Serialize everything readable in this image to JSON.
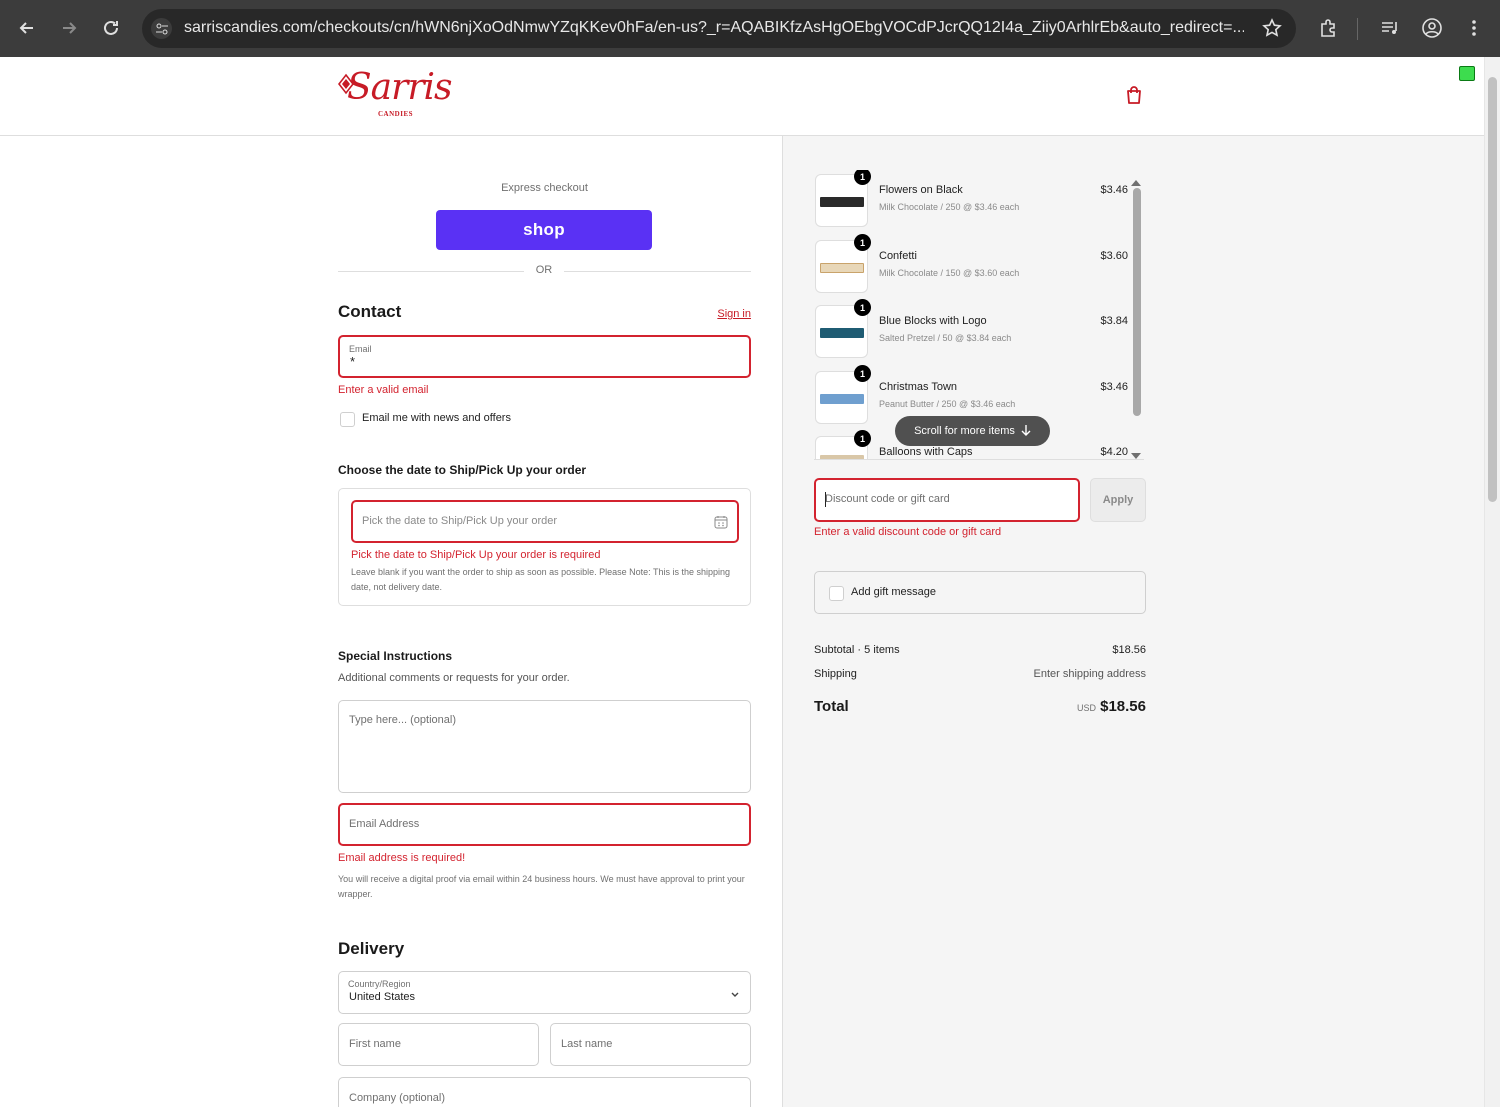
{
  "browser": {
    "url": "sarriscandies.com/checkouts/cn/hWN6njXoOdNmwYZqKKev0hFa/en-us?_r=AQABIKfzAsHgOEbgVOCdPJcrQQ12I4a_Ziiy0ArhlrEb&auto_redirect=..."
  },
  "brand": {
    "logo_text": "Sarris",
    "logo_sub": "CANDIES",
    "accent": "#c71b26"
  },
  "express": {
    "label": "Express checkout",
    "shop_label": "shop",
    "or_label": "OR"
  },
  "contact": {
    "heading": "Contact",
    "signin": "Sign in",
    "email_label": "Email",
    "email_value": "*",
    "email_error": "Enter a valid email",
    "newsletter_label": "Email me with news and offers"
  },
  "ship_date": {
    "heading": "Choose the date to Ship/Pick Up your order",
    "placeholder": "Pick the date to Ship/Pick Up your order",
    "error": "Pick the date to Ship/Pick Up your order is required",
    "note": "Leave blank if you want the order to ship as soon as possible. Please Note: This is the shipping date, not delivery date."
  },
  "special": {
    "heading": "Special Instructions",
    "description": "Additional comments or requests for your order.",
    "textarea_placeholder": "Type here... (optional)",
    "email_placeholder": "Email Address",
    "email_error": "Email address is required!",
    "note": "You will receive a digital proof via email within 24 business hours. We must have approval to print your wrapper."
  },
  "delivery": {
    "heading": "Delivery",
    "country_label": "Country/Region",
    "country_value": "United States",
    "first_name": "First name",
    "last_name": "Last name",
    "company": "Company (optional)"
  },
  "cart": {
    "items": [
      {
        "qty": "1",
        "name": "Flowers on Black",
        "sub": "Milk Chocolate / 250 @ $3.46 each",
        "price": "$3.46",
        "color": "#2a2a2a"
      },
      {
        "qty": "1",
        "name": "Confetti",
        "sub": "Milk Chocolate / 150 @ $3.60 each",
        "price": "$3.60",
        "color": "#e8d7b8"
      },
      {
        "qty": "1",
        "name": "Blue Blocks with Logo",
        "sub": "Salted Pretzel / 50 @ $3.84 each",
        "price": "$3.84",
        "color": "#1f5c73"
      },
      {
        "qty": "1",
        "name": "Christmas Town",
        "sub": "Peanut Butter / 250 @ $3.46 each",
        "price": "$3.46",
        "color": "#6f9fcf"
      },
      {
        "qty": "1",
        "name": "Balloons with Caps",
        "sub": "",
        "price": "$4.20",
        "color": "#d9c7a8"
      }
    ],
    "scroll_more": "Scroll for more items",
    "discount_placeholder": "Discount code or gift card",
    "apply_label": "Apply",
    "discount_error": "Enter a valid discount code or gift card",
    "gift_label": "Add gift message",
    "subtotal_label": "Subtotal · 5 items",
    "subtotal_value": "$18.56",
    "shipping_label": "Shipping",
    "shipping_value": "Enter shipping address",
    "total_label": "Total",
    "total_currency": "USD",
    "total_value": "$18.56"
  }
}
